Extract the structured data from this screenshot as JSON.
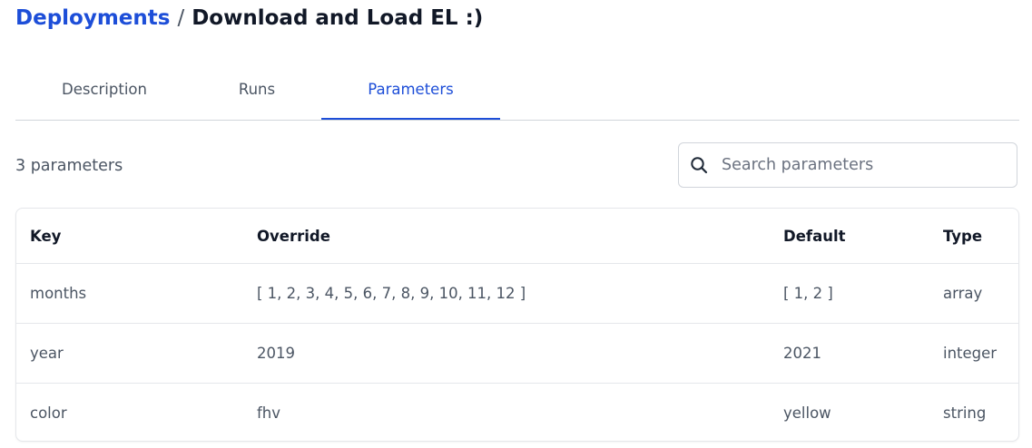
{
  "breadcrumb": {
    "parent": "Deployments",
    "separator": "/",
    "current": "Download and Load EL :)"
  },
  "tabs": [
    {
      "label": "Description",
      "active": false
    },
    {
      "label": "Runs",
      "active": false
    },
    {
      "label": "Parameters",
      "active": true
    }
  ],
  "parameters": {
    "count_label": "3 parameters",
    "search": {
      "placeholder": "Search parameters",
      "value": ""
    },
    "table": {
      "columns": [
        "Key",
        "Override",
        "Default",
        "Type"
      ],
      "rows": [
        {
          "key": "months",
          "override": "[ 1, 2, 3, 4, 5, 6, 7, 8, 9, 10, 11, 12 ]",
          "default": "[ 1, 2 ]",
          "type": "array"
        },
        {
          "key": "year",
          "override": "2019",
          "default": "2021",
          "type": "integer"
        },
        {
          "key": "color",
          "override": "fhv",
          "default": "yellow",
          "type": "string"
        }
      ]
    }
  },
  "colors": {
    "accent": "#1d4ed8",
    "text_muted": "#4b5563",
    "border": "#e5e7eb"
  },
  "icons": {
    "search": "search-icon"
  }
}
